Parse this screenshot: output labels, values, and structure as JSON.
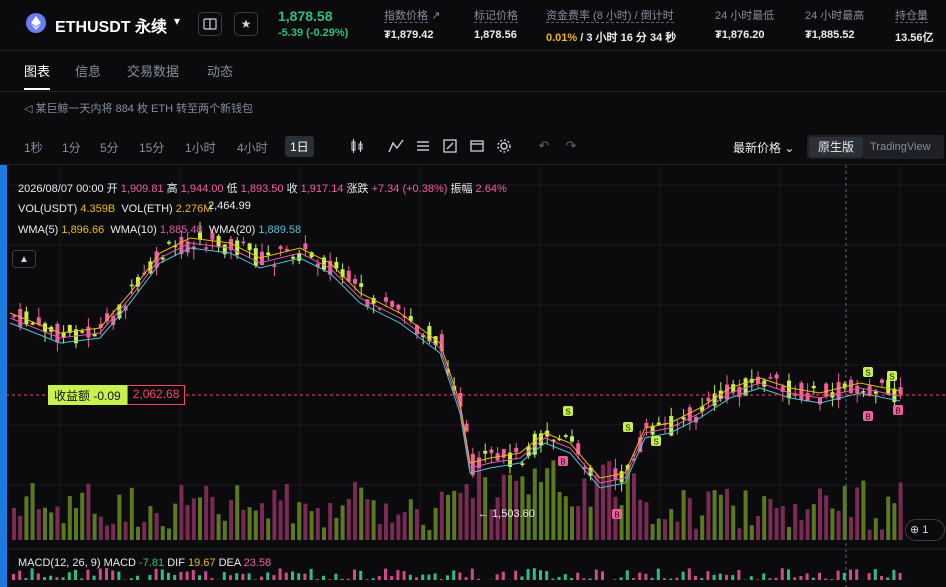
{
  "header": {
    "symbol": "ETHUSDT 永续",
    "price": "1,878.58",
    "change": "-5.39 (-0.29%)",
    "stats": [
      {
        "label": "指数价格",
        "value": "₮1,879.42"
      },
      {
        "label": "标记价格",
        "value": "1,878.56"
      },
      {
        "label": "资金费率 (8 小时) / 倒计时",
        "value_rate": "0.01%",
        "value_rest": " / 3 小时 16 分 34 秒"
      },
      {
        "label": "24 小时最低",
        "value": "₮1,876.20"
      },
      {
        "label": "24 小时最高",
        "value": "₮1,885.52"
      },
      {
        "label": "持仓量",
        "value": "13.56亿"
      }
    ],
    "icons": [
      "ethereum-icon",
      "chevron-down-icon",
      "book-icon",
      "star-icon",
      "external-link-icon"
    ]
  },
  "tabs": [
    "图表",
    "信息",
    "交易数据",
    "动态"
  ],
  "news": "某巨鲸一天内将 884 枚 ETH 转至两个新钱包",
  "toolbar": {
    "timeframes": [
      "1秒",
      "1分",
      "5分",
      "15分",
      "1小时",
      "4小时",
      "1日"
    ],
    "active_timeframe": "1日",
    "price_type": "最新价格",
    "view_original": "原生版",
    "view_tv": "TradingView",
    "icons": [
      "candlestick-icon",
      "indicator-icon",
      "layout-icon",
      "draw-icon",
      "template-icon",
      "settings-icon",
      "undo-icon",
      "redo-icon"
    ]
  },
  "legend": {
    "ohlc": {
      "date": "2026/08/07 00:00",
      "open_label": "开",
      "open": "1,909.81",
      "high_label": "高",
      "high": "1,944.00",
      "low_label": "低",
      "low": "1,893.50",
      "close_label": "收",
      "close": "1,917.14",
      "change_label": "涨跌",
      "change": "+7.34 (+0.38%)",
      "amp_label": "振幅",
      "amp": "2.64%"
    },
    "vol": {
      "usdt_label": "VOL(USDT)",
      "usdt": "4.359B",
      "eth_label": "VOL(ETH)",
      "eth": "2.276M"
    },
    "wma": {
      "w5_label": "WMA(5)",
      "w5": "1,896.66",
      "w10_label": "WMA(10)",
      "w10": "1,885.48",
      "w20_label": "WMA(20)",
      "w20": "1,889.58"
    },
    "macd": {
      "label": "MACD(12, 26, 9)",
      "macd_label": "MACD",
      "macd": "-7.81",
      "dif_label": "DIF",
      "dif": "19.67",
      "dea_label": "DEA",
      "dea": "23.58"
    }
  },
  "chart_labels": {
    "pnl_label": "收益额 -0.09",
    "pnl_price": "2,062.68",
    "max_label": "2,464.99",
    "min_label": "← 1,503.60",
    "zoom": "⊕ 1"
  },
  "colors": {
    "up": "#c6f24e",
    "down": "#f0609e",
    "bg": "#0b0b0d"
  }
}
